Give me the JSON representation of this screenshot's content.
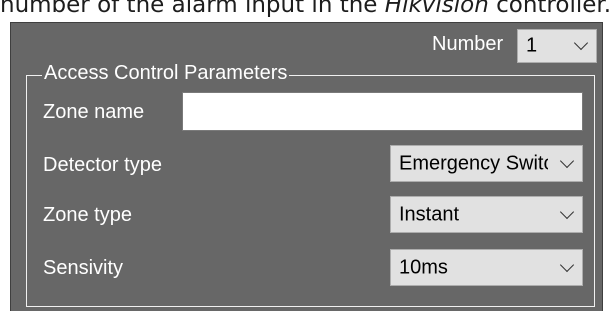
{
  "caption": {
    "prefix": "number of the alarm input in the ",
    "emphasis": "Hikvision",
    "suffix": " controller."
  },
  "number": {
    "label": "Number",
    "value": "1"
  },
  "group": {
    "title": "Access Control Parameters"
  },
  "fields": {
    "zone_name": {
      "label": "Zone name",
      "value": ""
    },
    "detector_type": {
      "label": "Detector type",
      "value": "Emergency Switc"
    },
    "zone_type": {
      "label": "Zone type",
      "value": "Instant"
    },
    "sensivity": {
      "label": "Sensivity",
      "value": "10ms"
    }
  },
  "icons": {
    "dropdown": "chevron-down-icon"
  },
  "colors": {
    "panel_bg": "#676767",
    "combo_bg": "#e1e1e1",
    "text_light": "#ffffff"
  }
}
